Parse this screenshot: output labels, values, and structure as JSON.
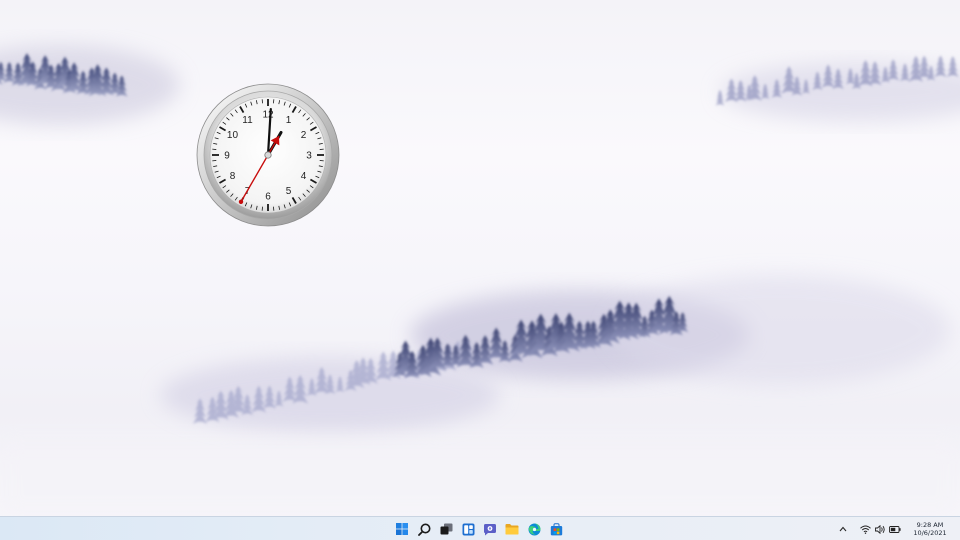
{
  "desktop": {
    "wallpaper": "misty-forest",
    "gadget": {
      "type": "analog-clock",
      "dial_numbers": [
        "12",
        "1",
        "2",
        "3",
        "4",
        "5",
        "6",
        "7",
        "8",
        "9",
        "10",
        "11"
      ],
      "time": {
        "hour": 1,
        "minute": 0,
        "second": 35
      },
      "hand_color": "#c80c0c"
    }
  },
  "taskbar": {
    "pinned": [
      {
        "name": "start",
        "icon": "windows-logo-icon"
      },
      {
        "name": "search",
        "icon": "search-icon"
      },
      {
        "name": "task-view",
        "icon": "task-view-icon"
      },
      {
        "name": "widgets",
        "icon": "widgets-icon"
      },
      {
        "name": "chat",
        "icon": "teams-chat-icon"
      },
      {
        "name": "file-explorer",
        "icon": "folder-icon"
      },
      {
        "name": "edge",
        "icon": "edge-browser-icon"
      },
      {
        "name": "store",
        "icon": "store-bag-icon"
      }
    ],
    "tray": {
      "chevron": "^",
      "icons": [
        "wifi-icon",
        "speaker-icon",
        "battery-icon"
      ],
      "time": "9:28 AM",
      "date": "10/6/2021"
    }
  },
  "colors": {
    "accent": "#0078d4",
    "taskbar_bg": "#e3ecf6",
    "tree": "#3b4275"
  }
}
